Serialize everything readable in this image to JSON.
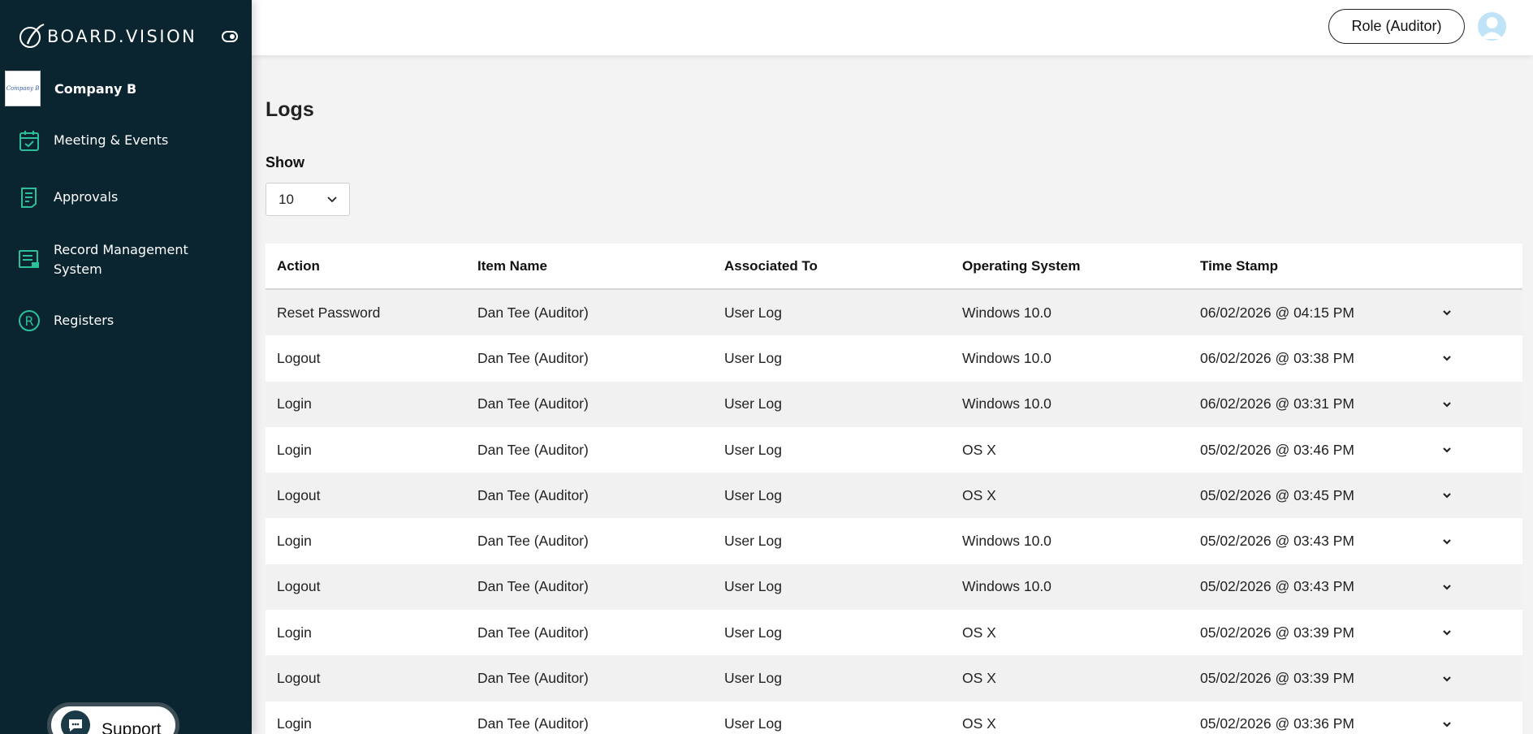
{
  "sidebar": {
    "brand": "BOARD.VISION",
    "company": {
      "name": "Company B",
      "logo_text": "Company B"
    },
    "items": [
      {
        "label": "Meeting & Events",
        "icon": "calendar-check-icon"
      },
      {
        "label": "Approvals",
        "icon": "document-list-icon"
      },
      {
        "label": "Record Management System",
        "icon": "record-monitor-icon"
      },
      {
        "label": "Registers",
        "icon": "registered-circle-icon"
      }
    ],
    "support": {
      "label": "Support",
      "icon": "chat-bubble-icon"
    }
  },
  "header": {
    "role_label": "Role (Auditor)",
    "avatar_icon": "user-avatar-icon"
  },
  "main": {
    "title": "Logs",
    "show_label": "Show",
    "show_value": "10",
    "columns": [
      "Action",
      "Item Name",
      "Associated To",
      "Operating System",
      "Time Stamp"
    ],
    "rows": [
      {
        "action": "Reset Password",
        "item": "Dan Tee (Auditor)",
        "assoc": "User Log",
        "os": "Windows 10.0",
        "time": "06/02/2026 @ 04:15 PM"
      },
      {
        "action": "Logout",
        "item": "Dan Tee (Auditor)",
        "assoc": "User Log",
        "os": "Windows 10.0",
        "time": "06/02/2026 @ 03:38 PM"
      },
      {
        "action": "Login",
        "item": "Dan Tee (Auditor)",
        "assoc": "User Log",
        "os": "Windows 10.0",
        "time": "06/02/2026 @ 03:31 PM"
      },
      {
        "action": "Login",
        "item": "Dan Tee (Auditor)",
        "assoc": "User Log",
        "os": "OS X",
        "time": "05/02/2026 @ 03:46 PM"
      },
      {
        "action": "Logout",
        "item": "Dan Tee (Auditor)",
        "assoc": "User Log",
        "os": "OS X",
        "time": "05/02/2026 @ 03:45 PM"
      },
      {
        "action": "Login",
        "item": "Dan Tee (Auditor)",
        "assoc": "User Log",
        "os": "Windows 10.0",
        "time": "05/02/2026 @ 03:43 PM"
      },
      {
        "action": "Logout",
        "item": "Dan Tee (Auditor)",
        "assoc": "User Log",
        "os": "Windows 10.0",
        "time": "05/02/2026 @ 03:43 PM"
      },
      {
        "action": "Login",
        "item": "Dan Tee (Auditor)",
        "assoc": "User Log",
        "os": "OS X",
        "time": "05/02/2026 @ 03:39 PM"
      },
      {
        "action": "Logout",
        "item": "Dan Tee (Auditor)",
        "assoc": "User Log",
        "os": "OS X",
        "time": "05/02/2026 @ 03:39 PM"
      },
      {
        "action": "Login",
        "item": "Dan Tee (Auditor)",
        "assoc": "User Log",
        "os": "OS X",
        "time": "05/02/2026 @ 03:36 PM"
      }
    ]
  },
  "colors": {
    "sidebar_bg": "#0b2530",
    "accent_green": "#2bbf9a",
    "row_stripe": "#f1f1f1"
  }
}
